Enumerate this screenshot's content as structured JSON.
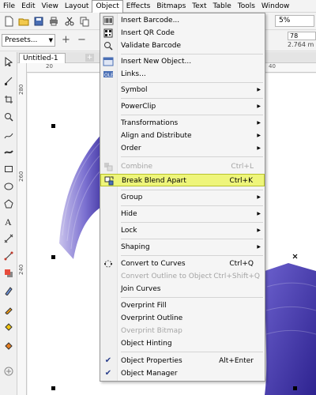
{
  "menubar": {
    "items": [
      "File",
      "Edit",
      "View",
      "Layout",
      "Object",
      "Effects",
      "Bitmaps",
      "Text",
      "Table",
      "Tools",
      "Window"
    ]
  },
  "toolbar": {
    "zoom": "5%"
  },
  "propertybar": {
    "presets_label": "Presets...",
    "size_value": "78",
    "size_text": "2.764 m"
  },
  "document": {
    "tab_title": "Untitled-1"
  },
  "ruler": {
    "h_labels": [
      "20",
      "40"
    ],
    "v_labels": [
      "280",
      "260",
      "240"
    ]
  },
  "object_menu": {
    "items": [
      {
        "label": "Insert Barcode...",
        "icon": "barcode-icon"
      },
      {
        "label": "Insert QR Code",
        "icon": "qr-code-icon"
      },
      {
        "label": "Validate Barcode",
        "icon": "validate-barcode-icon"
      },
      {
        "label": "Insert New Object...",
        "icon": "insert-object-icon"
      },
      {
        "label": "Links...",
        "icon": "ole-links-icon"
      },
      {
        "label": "Symbol"
      },
      {
        "label": "PowerClip"
      },
      {
        "label": "Transformations"
      },
      {
        "label": "Align and Distribute"
      },
      {
        "label": "Order"
      },
      {
        "label": "Combine",
        "shortcut": "Ctrl+L",
        "icon": "combine-icon"
      },
      {
        "label": "Break Blend Apart",
        "shortcut": "Ctrl+K",
        "icon": "break-apart-icon"
      },
      {
        "label": "Group"
      },
      {
        "label": "Hide"
      },
      {
        "label": "Lock"
      },
      {
        "label": "Shaping"
      },
      {
        "label": "Convert to Curves",
        "shortcut": "Ctrl+Q",
        "icon": "convert-curves-icon"
      },
      {
        "label": "Convert Outline to Object",
        "shortcut": "Ctrl+Shift+Q"
      },
      {
        "label": "Join Curves"
      },
      {
        "label": "Overprint Fill"
      },
      {
        "label": "Overprint Outline"
      },
      {
        "label": "Overprint Bitmap"
      },
      {
        "label": "Object Hinting"
      },
      {
        "label": "Object Properties",
        "shortcut": "Alt+Enter",
        "icon": "checkmark-icon"
      },
      {
        "label": "Object Manager",
        "icon": "checkmark-icon"
      }
    ]
  },
  "colors": {
    "highlight": "#eef57a",
    "blend_dark": "#3b2f9c",
    "blend_light": "#c9c3ec"
  }
}
